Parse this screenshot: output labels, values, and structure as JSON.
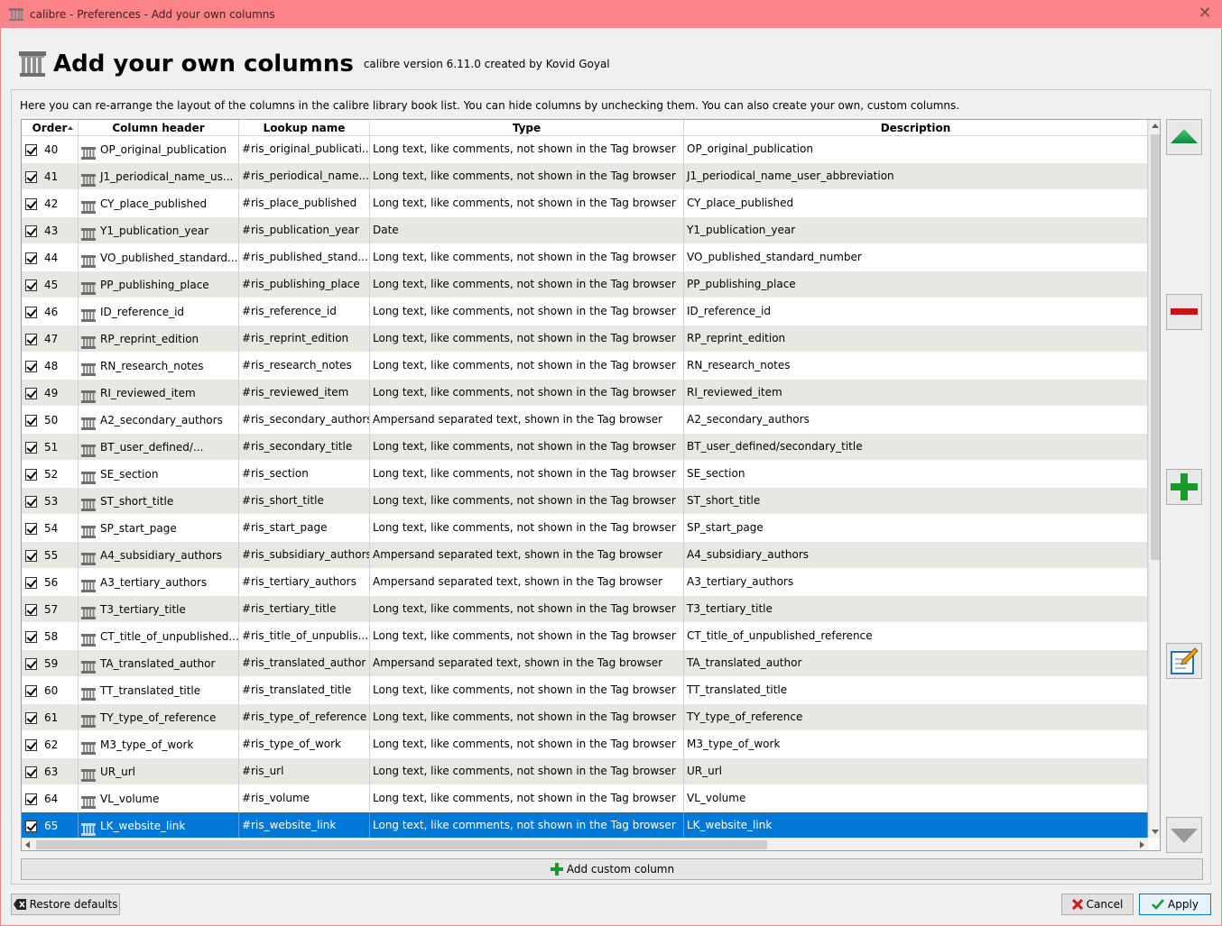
{
  "window": {
    "title": "calibre - Preferences - Add your own columns",
    "close_glyph": "✕"
  },
  "header": {
    "title": "Add your own columns",
    "version": "calibre version 6.11.0 created by Kovid Goyal"
  },
  "intro": "Here you can re-arrange the layout of the columns in the calibre library book list. You can hide columns by unchecking them. You can also create your own, custom columns.",
  "table": {
    "headers": {
      "order": "Order",
      "column_header": "Column header",
      "lookup_name": "Lookup name",
      "type": "Type",
      "description": "Description"
    },
    "rows": [
      {
        "order": "40",
        "header": "OP_original_publication",
        "lookup": "#ris_original_publicati...",
        "type": "Long text, like comments, not shown in the Tag browser",
        "desc": "OP_original_publication"
      },
      {
        "order": "41",
        "header": "J1_periodical_name_us...",
        "lookup": "#ris_periodical_name...",
        "type": "Long text, like comments, not shown in the Tag browser",
        "desc": "J1_periodical_name_user_abbreviation"
      },
      {
        "order": "42",
        "header": "CY_place_published",
        "lookup": "#ris_place_published",
        "type": "Long text, like comments, not shown in the Tag browser",
        "desc": "CY_place_published"
      },
      {
        "order": "43",
        "header": "Y1_publication_year",
        "lookup": "#ris_publication_year",
        "type": "Date",
        "desc": "Y1_publication_year"
      },
      {
        "order": "44",
        "header": "VO_published_standard...",
        "lookup": "#ris_published_stand...",
        "type": "Long text, like comments, not shown in the Tag browser",
        "desc": "VO_published_standard_number"
      },
      {
        "order": "45",
        "header": "PP_publishing_place",
        "lookup": "#ris_publishing_place",
        "type": "Long text, like comments, not shown in the Tag browser",
        "desc": "PP_publishing_place"
      },
      {
        "order": "46",
        "header": "ID_reference_id",
        "lookup": "#ris_reference_id",
        "type": "Long text, like comments, not shown in the Tag browser",
        "desc": "ID_reference_id"
      },
      {
        "order": "47",
        "header": "RP_reprint_edition",
        "lookup": "#ris_reprint_edition",
        "type": "Long text, like comments, not shown in the Tag browser",
        "desc": "RP_reprint_edition"
      },
      {
        "order": "48",
        "header": "RN_research_notes",
        "lookup": "#ris_research_notes",
        "type": "Long text, like comments, not shown in the Tag browser",
        "desc": "RN_research_notes"
      },
      {
        "order": "49",
        "header": "RI_reviewed_item",
        "lookup": "#ris_reviewed_item",
        "type": "Long text, like comments, not shown in the Tag browser",
        "desc": "RI_reviewed_item"
      },
      {
        "order": "50",
        "header": "A2_secondary_authors",
        "lookup": "#ris_secondary_authors",
        "type": "Ampersand separated text, shown in the Tag browser",
        "desc": "A2_secondary_authors"
      },
      {
        "order": "51",
        "header": "BT_user_defined/...",
        "lookup": "#ris_secondary_title",
        "type": "Long text, like comments, not shown in the Tag browser",
        "desc": "BT_user_defined/secondary_title"
      },
      {
        "order": "52",
        "header": "SE_section",
        "lookup": "#ris_section",
        "type": "Long text, like comments, not shown in the Tag browser",
        "desc": "SE_section"
      },
      {
        "order": "53",
        "header": "ST_short_title",
        "lookup": "#ris_short_title",
        "type": "Long text, like comments, not shown in the Tag browser",
        "desc": "ST_short_title"
      },
      {
        "order": "54",
        "header": "SP_start_page",
        "lookup": "#ris_start_page",
        "type": "Long text, like comments, not shown in the Tag browser",
        "desc": "SP_start_page"
      },
      {
        "order": "55",
        "header": "A4_subsidiary_authors",
        "lookup": "#ris_subsidiary_authors",
        "type": "Ampersand separated text, shown in the Tag browser",
        "desc": "A4_subsidiary_authors"
      },
      {
        "order": "56",
        "header": "A3_tertiary_authors",
        "lookup": "#ris_tertiary_authors",
        "type": "Ampersand separated text, shown in the Tag browser",
        "desc": "A3_tertiary_authors"
      },
      {
        "order": "57",
        "header": "T3_tertiary_title",
        "lookup": "#ris_tertiary_title",
        "type": "Long text, like comments, not shown in the Tag browser",
        "desc": "T3_tertiary_title"
      },
      {
        "order": "58",
        "header": "CT_title_of_unpublished...",
        "lookup": "#ris_title_of_unpublis...",
        "type": "Long text, like comments, not shown in the Tag browser",
        "desc": "CT_title_of_unpublished_reference"
      },
      {
        "order": "59",
        "header": "TA_translated_author",
        "lookup": "#ris_translated_author",
        "type": "Ampersand separated text, shown in the Tag browser",
        "desc": "TA_translated_author"
      },
      {
        "order": "60",
        "header": "TT_translated_title",
        "lookup": "#ris_translated_title",
        "type": "Long text, like comments, not shown in the Tag browser",
        "desc": "TT_translated_title"
      },
      {
        "order": "61",
        "header": "TY_type_of_reference",
        "lookup": "#ris_type_of_reference",
        "type": "Long text, like comments, not shown in the Tag browser",
        "desc": "TY_type_of_reference"
      },
      {
        "order": "62",
        "header": "M3_type_of_work",
        "lookup": "#ris_type_of_work",
        "type": "Long text, like comments, not shown in the Tag browser",
        "desc": "M3_type_of_work"
      },
      {
        "order": "63",
        "header": "UR_url",
        "lookup": "#ris_url",
        "type": "Long text, like comments, not shown in the Tag browser",
        "desc": "UR_url"
      },
      {
        "order": "64",
        "header": "VL_volume",
        "lookup": "#ris_volume",
        "type": "Long text, like comments, not shown in the Tag browser",
        "desc": "VL_volume"
      },
      {
        "order": "65",
        "header": "LK_website_link",
        "lookup": "#ris_website_link",
        "type": "Long text, like comments, not shown in the Tag browser",
        "desc": "LK_website_link",
        "selected": true
      }
    ]
  },
  "side_buttons": {
    "move_up": "arrow-up-icon",
    "remove": "minus-icon",
    "add": "plus-icon",
    "edit": "edit-icon",
    "move_down": "arrow-down-icon"
  },
  "buttons": {
    "add_custom_column": "Add custom column",
    "restore_defaults": "Restore defaults",
    "cancel": "Cancel",
    "apply": "Apply"
  },
  "colors": {
    "titlebar": "#fc8387",
    "selection": "#0078d7",
    "alt_row": "#e9e7e3"
  }
}
